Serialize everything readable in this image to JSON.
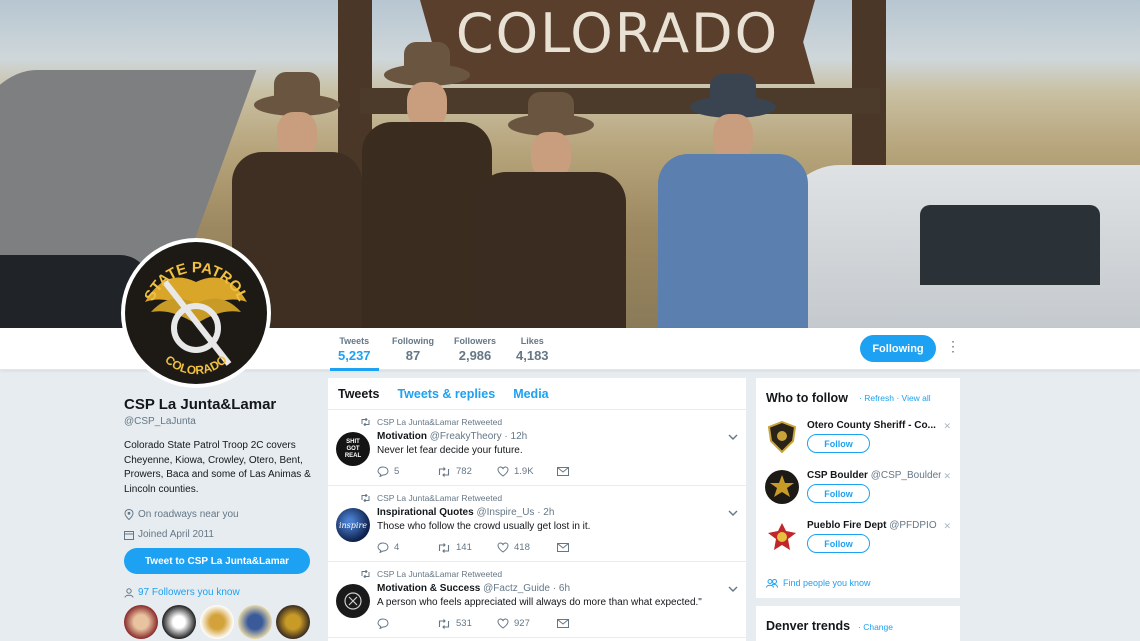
{
  "banner": {
    "sign_text": "COLORADO"
  },
  "nav": {
    "stats": [
      {
        "label": "Tweets",
        "value": "5,237"
      },
      {
        "label": "Following",
        "value": "87"
      },
      {
        "label": "Followers",
        "value": "2,986"
      },
      {
        "label": "Likes",
        "value": "4,183"
      }
    ],
    "following_button": "Following",
    "more": "⋮"
  },
  "avatar": {
    "top_text": "STATE PATROL",
    "bottom_text": "COLORADO"
  },
  "profile": {
    "name": "CSP La Junta&Lamar",
    "handle": "@CSP_LaJunta",
    "bio": "Colorado State Patrol Troop 2C covers Cheyenne, Kiowa, Crowley, Otero, Bent, Prowers, Baca and some of Las Animas & Lincoln counties.",
    "location": "On roadways near you",
    "joined": "Joined April 2011",
    "tweet_to_button": "Tweet to CSP La Junta&Lamar",
    "followers_you_know": "97 Followers you know"
  },
  "timeline": {
    "tabs": [
      "Tweets",
      "Tweets & replies",
      "Media"
    ],
    "tweets": [
      {
        "retweeted_by": "CSP La Junta&Lamar Retweeted",
        "name": "Motivation",
        "handle": "@FreakyTheory",
        "time": "· 12h",
        "text": "Never let fear decide your future.",
        "replies": "5",
        "retweets": "782",
        "likes": "1.9K",
        "avatar_text": "SHIT GOT REAL"
      },
      {
        "retweeted_by": "CSP La Junta&Lamar Retweeted",
        "name": "Inspirational Quotes",
        "handle": "@Inspire_Us",
        "time": "· 2h",
        "text": "Those who follow the crowd usually get lost in it.",
        "replies": "4",
        "retweets": "141",
        "likes": "418",
        "avatar_text": "inspire"
      },
      {
        "retweeted_by": "CSP La Junta&Lamar Retweeted",
        "name": "Motivation & Success",
        "handle": "@Factz_Guide",
        "time": "· 6h",
        "text": "A person who feels appreciated will always do more than what expected.\"",
        "replies": "",
        "retweets": "531",
        "likes": "927",
        "avatar_text": ""
      }
    ]
  },
  "who_to_follow": {
    "title": "Who to follow",
    "refresh": "Refresh",
    "view_all": "View all",
    "suggestions": [
      {
        "name": "Otero County Sheriff - Co...",
        "handle": "",
        "button": "Follow"
      },
      {
        "name": "CSP Boulder",
        "handle": "@CSP_Boulder",
        "button": "Follow"
      },
      {
        "name": "Pueblo Fire Dept",
        "handle": "@PFDPIO",
        "button": "Follow"
      }
    ],
    "find_people": "Find people you know"
  },
  "trends": {
    "title": "Denver trends",
    "change": "Change"
  },
  "colors": {
    "accent": "#1da1f2",
    "page_bg": "#e6ecf0",
    "muted": "#657786"
  }
}
